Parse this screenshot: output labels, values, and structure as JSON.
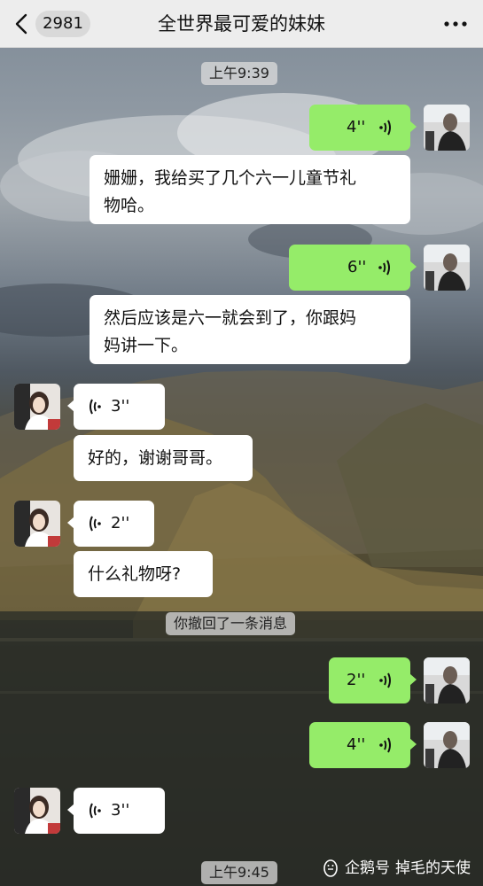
{
  "header": {
    "unread_count": "2981",
    "title": "全世界最可爱的妹妹"
  },
  "messages": [
    {
      "type": "time",
      "text": "上午9:39"
    },
    {
      "type": "voice",
      "side": "right",
      "duration": "4''"
    },
    {
      "type": "text",
      "side": "right",
      "lines": [
        "姗姗，我给买了几个六一儿童节礼",
        "物哈。"
      ]
    },
    {
      "type": "voice",
      "side": "right",
      "duration": "6''"
    },
    {
      "type": "text",
      "side": "right",
      "lines": [
        "然后应该是六一就会到了，你跟妈",
        "妈讲一下。"
      ]
    },
    {
      "type": "voice",
      "side": "left",
      "duration": "3''"
    },
    {
      "type": "text",
      "side": "left",
      "lines": [
        "好的，谢谢哥哥。"
      ]
    },
    {
      "type": "voice",
      "side": "left",
      "duration": "2''"
    },
    {
      "type": "text",
      "side": "left",
      "lines": [
        "什么礼物呀?"
      ]
    },
    {
      "type": "notice",
      "text": "你撤回了一条消息"
    },
    {
      "type": "voice",
      "side": "right",
      "duration": "2''"
    },
    {
      "type": "voice",
      "side": "right",
      "duration": "4''"
    },
    {
      "type": "voice",
      "side": "left",
      "duration": "3''"
    },
    {
      "type": "time",
      "text": "上午9:45"
    }
  ],
  "watermark": {
    "brand": "企鹅号",
    "author": "掉毛的天使"
  },
  "colors": {
    "bubble_green": "#95ec69",
    "bubble_white": "#ffffff",
    "header_bg": "#ededed"
  }
}
